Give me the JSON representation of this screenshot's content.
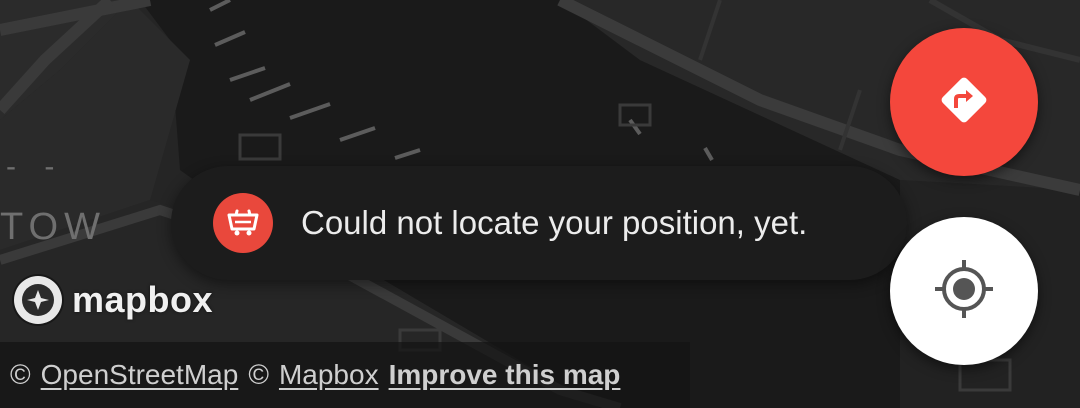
{
  "map": {
    "labels": {
      "town": "TOW",
      "dash": "- -"
    }
  },
  "branding": {
    "logo_text": "mapbox",
    "logo_icon": "mapbox-compass-icon"
  },
  "attribution": {
    "copyright1": "©",
    "link1": "OpenStreetMap",
    "copyright2": "©",
    "link2": "Mapbox",
    "link3": "Improve this map"
  },
  "toast": {
    "icon": "tram-icon",
    "message": "Could not locate your position, yet."
  },
  "buttons": {
    "directions_icon": "directions-turn-right-icon",
    "locate_icon": "my-location-icon"
  },
  "colors": {
    "accent_red": "#f4473c",
    "map_bg": "#232323",
    "toast_bg": "#1c1c1c"
  }
}
